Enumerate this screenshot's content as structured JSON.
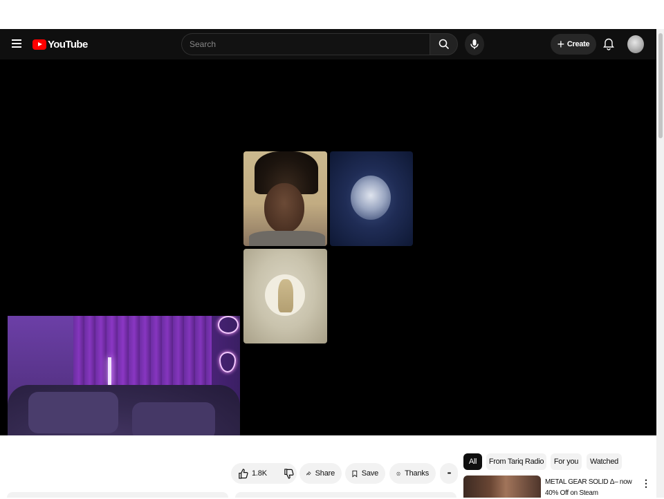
{
  "masthead": {
    "logo_text": "YouTube",
    "search_placeholder": "Search",
    "create_label": "Create"
  },
  "actions": {
    "like_count": "1.8K",
    "share_label": "Share",
    "save_label": "Save",
    "thanks_label": "Thanks",
    "more_label": "•••"
  },
  "chips": [
    "All",
    "From Tariq Radio",
    "For you",
    "Watched"
  ],
  "recommendation": {
    "title_line1": "METAL GEAR SOLID Δ– now",
    "title_line2": "40% Off on Steam",
    "more_label": "⋮"
  },
  "colors": {
    "masthead_bg": "#0f0f0f",
    "brand_red": "#ff0000",
    "chip_active_bg": "#0f0f0f",
    "pill_bg": "#f2f2f2"
  },
  "icons": {
    "menu": "hamburger-icon",
    "search": "search-icon",
    "mic": "microphone-icon",
    "create": "plus-icon",
    "notifications": "bell-icon",
    "like": "thumbs-up-icon",
    "dislike": "thumbs-down-icon",
    "share": "share-arrow-icon",
    "save": "bookmark-icon",
    "thanks": "super-thanks-icon"
  }
}
